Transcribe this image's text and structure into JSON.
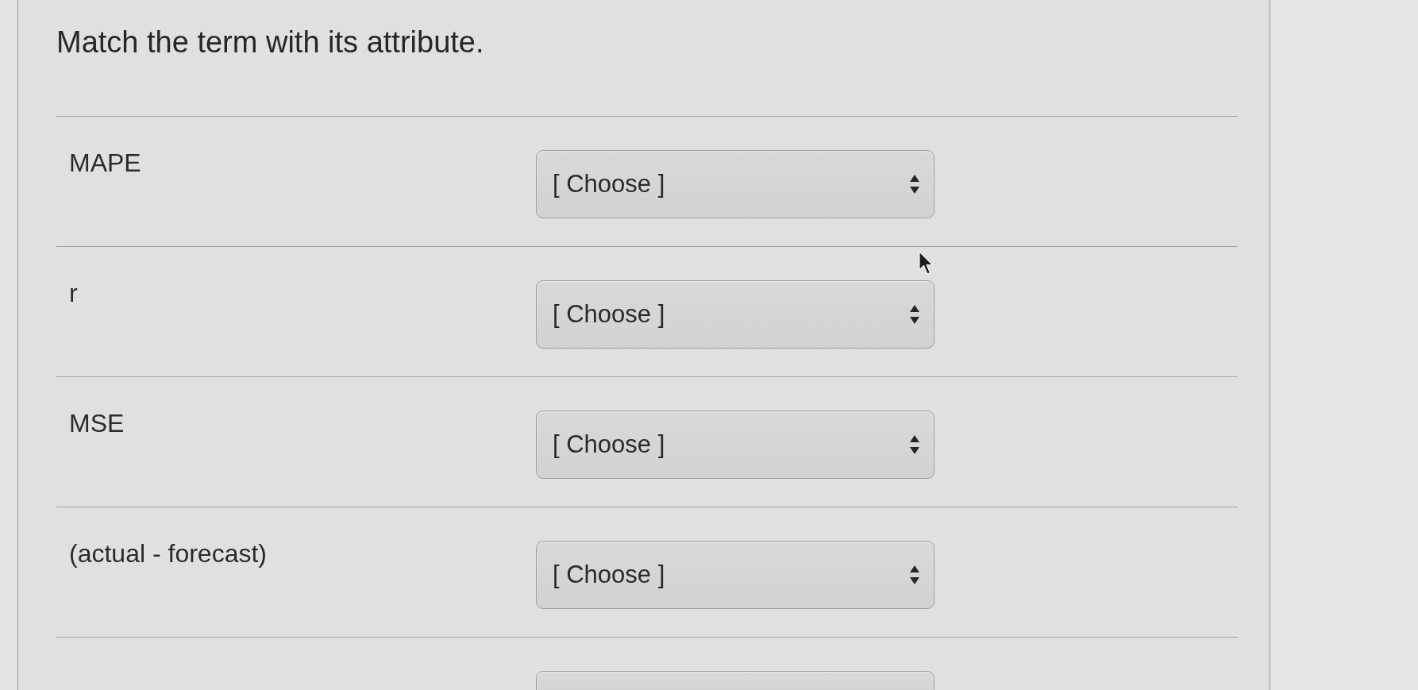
{
  "question": {
    "title": "Match the term with its attribute."
  },
  "rows": [
    {
      "kind": "full",
      "term": "MAPE",
      "value": "[ Choose ]"
    },
    {
      "kind": "full",
      "term": "r",
      "value": "[ Choose ]"
    },
    {
      "kind": "full",
      "term": "MSE",
      "value": "[ Choose ]"
    },
    {
      "kind": "full",
      "term": "(actual - forecast)",
      "value": "[ Choose ]"
    },
    {
      "kind": "cut"
    }
  ]
}
